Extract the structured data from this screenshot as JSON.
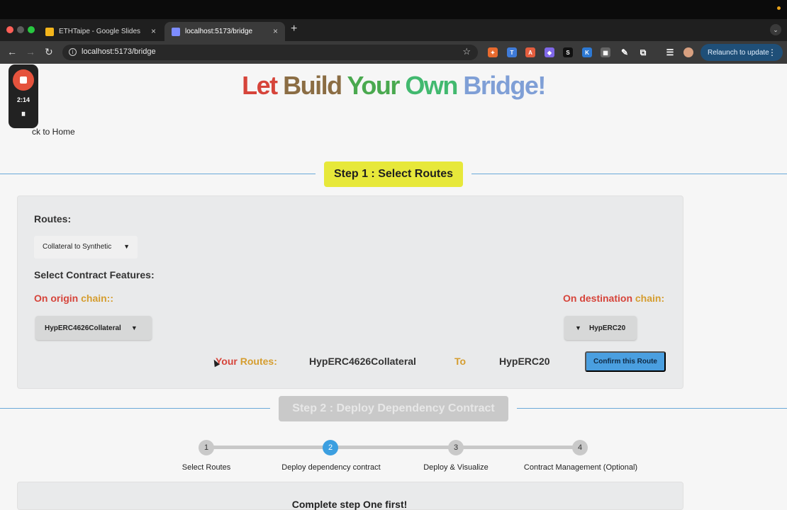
{
  "browser": {
    "tabs": [
      {
        "label": "ETHTaipe - Google Slides",
        "favicon_color": "#f3b51b",
        "close": "×"
      },
      {
        "label": "localhost:5173/bridge",
        "favicon_color": "#7d8cff",
        "close": "×"
      }
    ],
    "new_tab": "+",
    "url": "localhost:5173/bridge",
    "relaunch_label": "Relaunch to update",
    "nav": {
      "back": "←",
      "forward": "→",
      "reload": "↻"
    },
    "bookmark_icon": "☆"
  },
  "recorder": {
    "time": "2:14",
    "pause": "⏸"
  },
  "page": {
    "hero_words": [
      {
        "text": "Let ",
        "color": "#d6443a"
      },
      {
        "text": "Build ",
        "color": "#8b6d44"
      },
      {
        "text": "Your ",
        "color": "#4aa94f"
      },
      {
        "text": "Own ",
        "color": "#42b96f"
      },
      {
        "text": "Bridge!",
        "color": "#7f9fd6"
      }
    ],
    "back_link": "ck to Home",
    "step1_title": "Step 1 : Select Routes",
    "routes_label": "Routes:",
    "routes_value": "Collateral to Synthetic",
    "features_label": "Select Contract Features:",
    "origin_prefix": "On origin ",
    "origin_suffix": "chain::",
    "dest_prefix": "On destination ",
    "dest_suffix": "chain:",
    "origin_contract": "HypERC4626Collateral",
    "dest_contract": "HypERC20",
    "your_routes_prefix": "Your ",
    "your_routes_suffix": "Routes:",
    "route_from": "HypERC4626Collateral",
    "route_to_label": "To",
    "route_to": "HypERC20",
    "confirm_label": "Confirm this Route",
    "step2_title": "Step 2 : Deploy Dependency Contract",
    "steps": [
      {
        "number": "1",
        "label": "Select Routes"
      },
      {
        "number": "2",
        "label": "Deploy dependency contract"
      },
      {
        "number": "3",
        "label": "Deploy & Visualize"
      },
      {
        "number": "4",
        "label": "Contract Management (Optional)"
      }
    ],
    "active_step": 2,
    "bottom_message": "Complete step One first!"
  }
}
